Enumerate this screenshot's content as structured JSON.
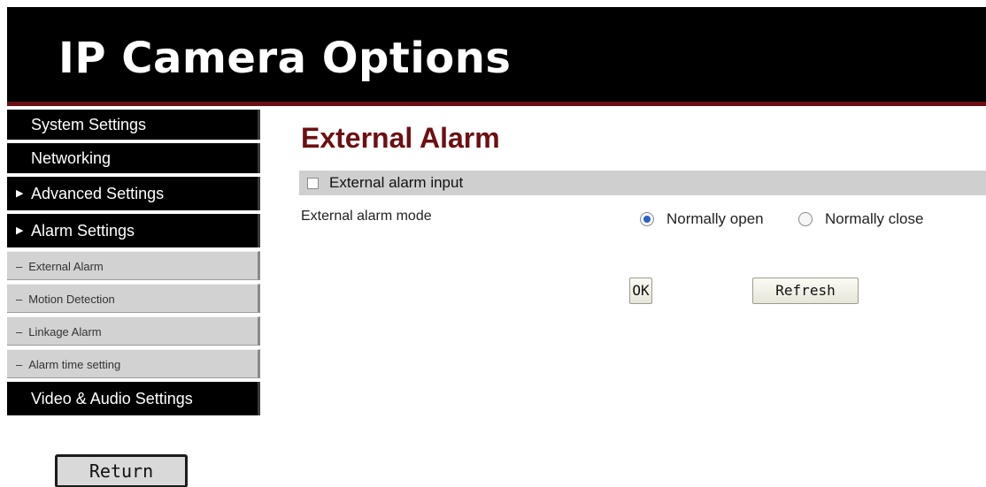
{
  "header": {
    "title": "IP Camera Options"
  },
  "sidebar": {
    "items": [
      {
        "label": "System Settings"
      },
      {
        "label": "Networking"
      },
      {
        "label": "Advanced Settings"
      },
      {
        "label": "Alarm Settings"
      }
    ],
    "sub_items": [
      {
        "label": "External Alarm"
      },
      {
        "label": "Motion Detection"
      },
      {
        "label": "Linkage Alarm"
      },
      {
        "label": "Alarm time setting"
      }
    ],
    "last_item": {
      "label": "Video & Audio Settings"
    },
    "return_label": "Return"
  },
  "main": {
    "title": "External Alarm",
    "alarm_input_label": "External alarm input",
    "alarm_input_checked": false,
    "mode_label": "External alarm mode",
    "mode_options": [
      "Normally open",
      "Normally close"
    ],
    "mode_selected": "Normally open",
    "ok_label": "OK",
    "refresh_label": "Refresh"
  },
  "colors": {
    "header_bg": "#000000",
    "accent": "#6e0f12",
    "section_bar": "#cfcfcf",
    "radio_selected": "#2a63c8"
  },
  "icons": {
    "submenu_marker": "arrow-right-icon",
    "sub_item_marker": "dash-icon"
  }
}
